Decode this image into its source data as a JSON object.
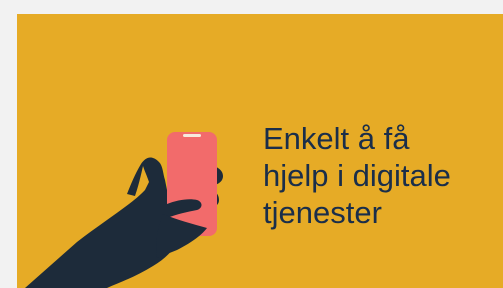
{
  "banner": {
    "headline_lines": [
      "Enkelt å få",
      "hjelp i digitale",
      "tjenester"
    ]
  },
  "colors": {
    "background": "#e6ab26",
    "outer_background": "#f2f2f2",
    "text": "#1a2e4a",
    "hand": "#1d2b3a",
    "phone": "#f26b6b",
    "phone_notch": "#f7e9dc"
  },
  "icons": {
    "illustration": "hand-holding-phone-icon"
  }
}
